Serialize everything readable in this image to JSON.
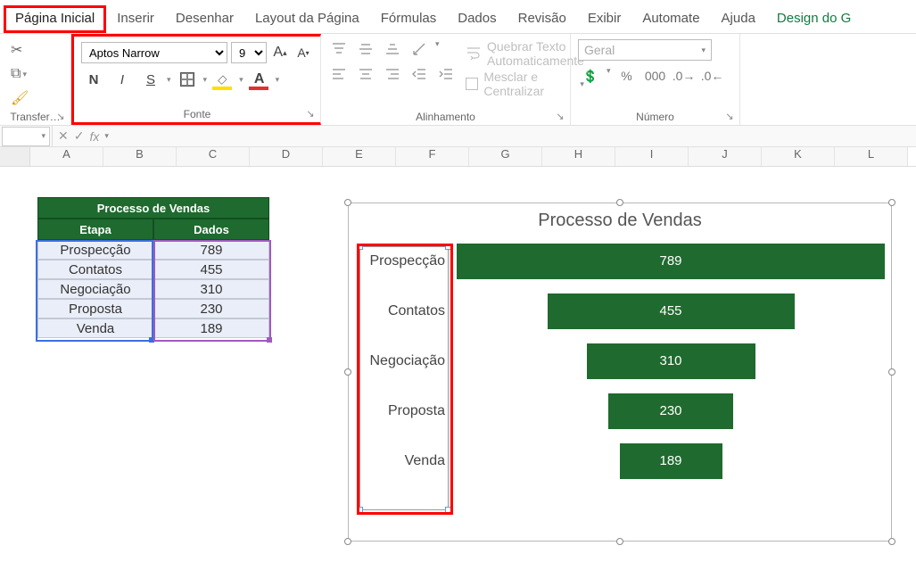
{
  "ribbon_tabs": {
    "home": "Página Inicial",
    "insert": "Inserir",
    "draw": "Desenhar",
    "layout": "Layout da Página",
    "formulas": "Fórmulas",
    "data": "Dados",
    "review": "Revisão",
    "view": "Exibir",
    "automate": "Automate",
    "help": "Ajuda",
    "design": "Design do G"
  },
  "font": {
    "name": "Aptos Narrow",
    "size": "9",
    "group_label": "Fonte"
  },
  "clipboard": {
    "label": "Transfer…"
  },
  "alignment": {
    "wrap_text": "Quebrar Texto Automaticamente",
    "merge_center": "Mesclar e Centralizar",
    "group_label": "Alinhamento"
  },
  "number": {
    "format": "Geral",
    "group_label": "Número"
  },
  "formula_bar": {
    "fx": "fx",
    "value": ""
  },
  "columns": [
    "A",
    "B",
    "C",
    "D",
    "E",
    "F",
    "G",
    "H",
    "I",
    "J",
    "K",
    "L"
  ],
  "table": {
    "title": "Processo de Vendas",
    "col1": "Etapa",
    "col2": "Dados",
    "rows": [
      {
        "etapa": "Prospecção",
        "dados": "789"
      },
      {
        "etapa": "Contatos",
        "dados": "455"
      },
      {
        "etapa": "Negociação",
        "dados": "310"
      },
      {
        "etapa": "Proposta",
        "dados": "230"
      },
      {
        "etapa": "Venda",
        "dados": "189"
      }
    ]
  },
  "chart_data": {
    "type": "bar",
    "title": "Processo de Vendas",
    "categories": [
      "Prospecção",
      "Contatos",
      "Negociação",
      "Proposta",
      "Venda"
    ],
    "values": [
      789,
      455,
      310,
      230,
      189
    ],
    "xlabel": "",
    "ylabel": "",
    "ylim": [
      0,
      800
    ]
  }
}
